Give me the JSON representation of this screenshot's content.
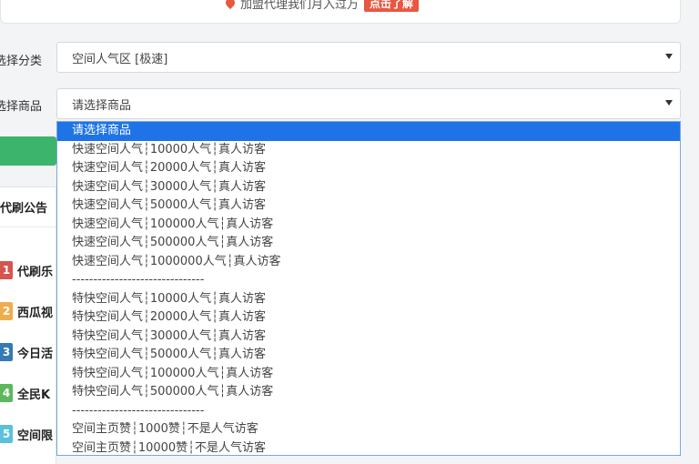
{
  "banner": {
    "text": "加盟代理我们月入过万",
    "button": "点击了解"
  },
  "form": {
    "category_label": "选择分类",
    "category_value": "空间人气区 [极速]",
    "product_label": "选择商品",
    "product_value": "请选择商品"
  },
  "announcement": {
    "title": "代刷公告",
    "items": [
      {
        "num": "1",
        "text": "代刷乐",
        "color": "#d9534f"
      },
      {
        "num": "2",
        "text": "西瓜视",
        "color": "#f0ad4e"
      },
      {
        "num": "3",
        "text": "今日活",
        "color": "#337ab7"
      },
      {
        "num": "4",
        "text": "全民K",
        "color": "#5cb85c"
      },
      {
        "num": "5",
        "text": "空间限",
        "color": "#5bc0de"
      }
    ]
  },
  "dropdown": {
    "options": [
      "请选择商品",
      "快速空间人气┆10000人气┆真人访客",
      "快速空间人气┆20000人气┆真人访客",
      "快速空间人气┆30000人气┆真人访客",
      "快速空间人气┆50000人气┆真人访客",
      "快速空间人气┆100000人气┆真人访客",
      "快速空间人气┆500000人气┆真人访客",
      "快速空间人气┆1000000人气┆真人访客",
      "-------------------------------",
      "特快空间人气┆10000人气┆真人访客",
      "特快空间人气┆20000人气┆真人访客",
      "特快空间人气┆30000人气┆真人访客",
      "特快空间人气┆50000人气┆真人访客",
      "特快空间人气┆100000人气┆真人访客",
      "特快空间人气┆500000人气┆真人访客",
      "-------------------------------",
      "空间主页赞┆1000赞┆不是人气访客",
      "空间主页赞┆10000赞┆不是人气访客"
    ]
  },
  "colors": {
    "accent": "#1e74e6",
    "promo": "#e8573f",
    "green": "#3cb46c"
  }
}
